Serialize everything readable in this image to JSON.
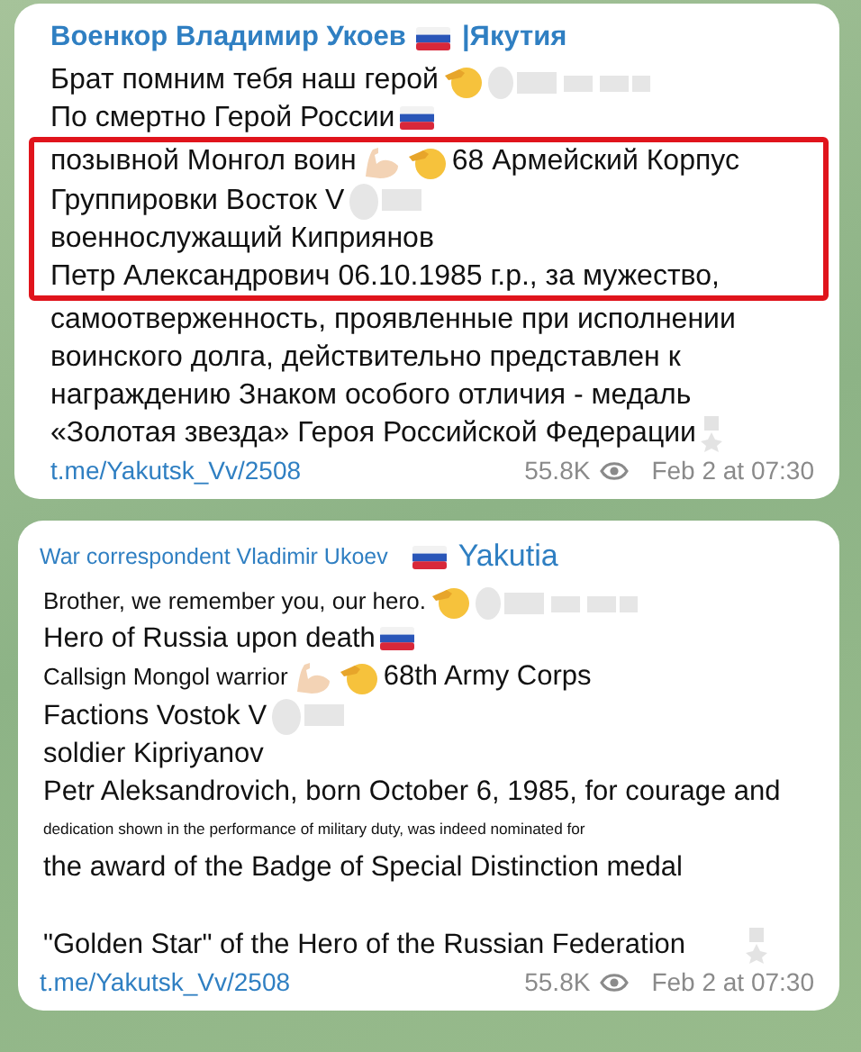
{
  "posts": [
    {
      "title": [
        {
          "kind": "text",
          "text": "Военкор Владимир Укоев"
        },
        {
          "kind": "flag"
        },
        {
          "kind": "text",
          "text": "|Якутия"
        }
      ],
      "lines": [
        {
          "highlighted": false,
          "segments": [
            {
              "kind": "text",
              "text": "Брат помним тебя наш герой"
            },
            {
              "kind": "salute"
            },
            {
              "kind": "blurlong"
            }
          ]
        },
        {
          "highlighted": false,
          "segments": [
            {
              "kind": "text",
              "text": "По смертно Герой России"
            },
            {
              "kind": "flag"
            }
          ]
        },
        {
          "highlighted": true,
          "segments": [
            {
              "kind": "text",
              "text": "позывной Монгол воин"
            },
            {
              "kind": "muscle"
            },
            {
              "kind": "salute"
            },
            {
              "kind": "text",
              "text": "68 Армейский Корпус"
            }
          ]
        },
        {
          "highlighted": true,
          "segments": [
            {
              "kind": "text",
              "text": "Группировки Восток V"
            },
            {
              "kind": "blurshort"
            }
          ]
        },
        {
          "highlighted": true,
          "segments": [
            {
              "kind": "text",
              "text": "военнослужащий Киприянов"
            }
          ]
        },
        {
          "highlighted": true,
          "segments": [
            {
              "kind": "text",
              "text": "Петр Александрович 06.10.1985 г.р., за мужество,"
            }
          ]
        },
        {
          "highlighted": false,
          "segments": [
            {
              "kind": "text",
              "text": "самоотверженность, проявленные при исполнении"
            }
          ]
        },
        {
          "highlighted": false,
          "segments": [
            {
              "kind": "text",
              "text": "воинского долга, действительно представлен к"
            }
          ]
        },
        {
          "highlighted": false,
          "segments": [
            {
              "kind": "text",
              "text": "награждению Знаком особого отличия - медаль"
            }
          ]
        },
        {
          "highlighted": false,
          "segments": [
            {
              "kind": "text",
              "text": "«Золотая звезда» Героя Российской Федерации"
            },
            {
              "kind": "medal"
            }
          ]
        }
      ],
      "link": "t.me/Yakutsk_Vv/2508",
      "views": "55.8K",
      "date": "Feb 2 at 07:30"
    },
    {
      "title": [
        {
          "kind": "caption",
          "text": "War correspondent Vladimir Ukoev"
        },
        {
          "kind": "flag"
        },
        {
          "kind": "text",
          "text": "Yakutia"
        }
      ],
      "lines": [
        {
          "highlighted": false,
          "segments": [
            {
              "kind": "caption",
              "text": "Brother, we remember you, our hero."
            },
            {
              "kind": "salute"
            },
            {
              "kind": "blurlong"
            }
          ]
        },
        {
          "highlighted": false,
          "segments": [
            {
              "kind": "text",
              "text": "Hero of Russia upon death"
            },
            {
              "kind": "flag"
            }
          ]
        },
        {
          "highlighted": false,
          "segments": [
            {
              "kind": "caption",
              "text": "Callsign Mongol warrior"
            },
            {
              "kind": "muscle"
            },
            {
              "kind": "salute"
            },
            {
              "kind": "text",
              "text": "68th Army Corps"
            }
          ]
        },
        {
          "highlighted": false,
          "segments": [
            {
              "kind": "text",
              "text": "Factions Vostok V"
            },
            {
              "kind": "blurshort"
            }
          ]
        },
        {
          "highlighted": false,
          "segments": [
            {
              "kind": "text",
              "text": "soldier Kipriyanov"
            }
          ]
        },
        {
          "highlighted": false,
          "segments": [
            {
              "kind": "text",
              "text": "Petr Aleksandrovich, born October 6, 1985, for courage and"
            }
          ]
        },
        {
          "highlighted": false,
          "segments": [
            {
              "kind": "fine",
              "text": "dedication shown in the performance of military duty, was indeed nominated for"
            }
          ]
        },
        {
          "highlighted": false,
          "segments": [
            {
              "kind": "text",
              "text": "the award of the Badge of Special Distinction medal"
            }
          ]
        },
        {
          "highlighted": false,
          "segments": [
            {
              "kind": "text",
              "text": "\"Golden Star\" of the Hero of the Russian Federation"
            },
            {
              "kind": "medal"
            }
          ]
        }
      ],
      "link": "t.me/Yakutsk_Vv/2508",
      "views": "55.8K",
      "date": "Feb 2 at 07:30"
    }
  ]
}
